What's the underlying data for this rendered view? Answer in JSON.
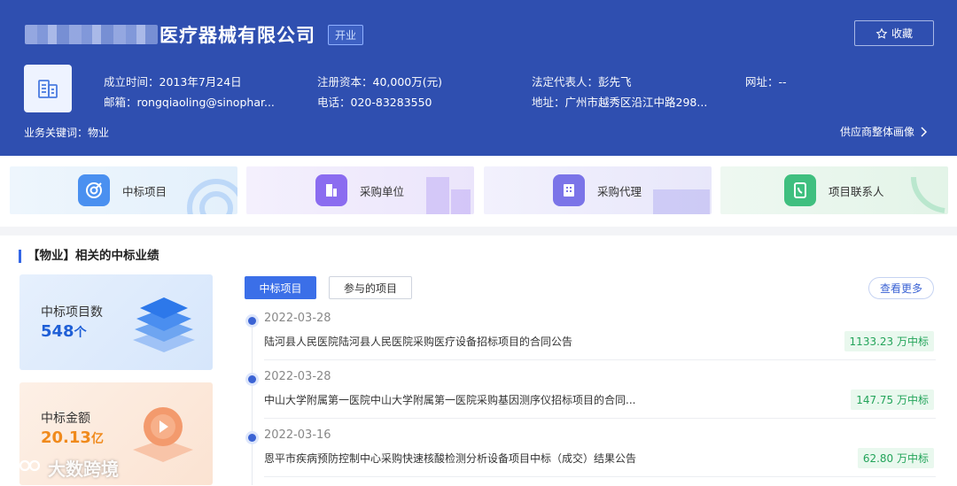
{
  "header": {
    "company_name": "医疗器械有限公司",
    "status": "开业",
    "favorite_label": "收藏",
    "founded_label": "成立时间：",
    "founded_value": "2013年7月24日",
    "capital_label": "注册资本：",
    "capital_value": "40,000万(元)",
    "legal_rep_label": "法定代表人：",
    "legal_rep_value": "彭先飞",
    "website_label": "网址：",
    "website_value": "--",
    "email_label": "邮箱：",
    "email_value": "rongqiaoling@sinophar...",
    "phone_label": "电话：",
    "phone_value": "020-83283550",
    "address_label": "地址：",
    "address_value": "广州市越秀区沿江中路298...",
    "keywords_label": "业务关键词：",
    "keywords_value": "物业",
    "portrait_link": "供应商整体画像"
  },
  "nav_cards": [
    {
      "label": "中标项目",
      "icon": "target-check-icon",
      "color": "#4a90f0"
    },
    {
      "label": "采购单位",
      "icon": "building-icon",
      "color": "#8b6cf0"
    },
    {
      "label": "采购代理",
      "icon": "office-building-icon",
      "color": "#7b74e8"
    },
    {
      "label": "项目联系人",
      "icon": "phone-book-icon",
      "color": "#3fbf7f"
    }
  ],
  "section": {
    "title": "【物业】相关的中标业绩",
    "stats": [
      {
        "label": "中标项目数",
        "value": "548",
        "unit": "个",
        "color": "#1f5fd6"
      },
      {
        "label": "中标金额",
        "value": "20.13",
        "unit": "亿",
        "color": "#f08a1c"
      }
    ],
    "tabs": [
      {
        "label": "中标项目",
        "active": true
      },
      {
        "label": "参与的项目",
        "active": false
      }
    ],
    "more_label": "查看更多",
    "records": [
      {
        "date": "2022-03-28",
        "title": "陆河县人民医院陆河县人民医院采购医疗设备招标项目的合同公告",
        "amount": "1133.23 万中标"
      },
      {
        "date": "2022-03-28",
        "title": "中山大学附属第一医院中山大学附属第一医院采购基因测序仪招标项目的合同...",
        "amount": "147.75 万中标"
      },
      {
        "date": "2022-03-16",
        "title": "恩平市疾病预防控制中心采购快速核酸检测分析设备项目中标（成交）结果公告",
        "amount": "62.80 万中标"
      }
    ]
  },
  "watermark": "大数跨境"
}
